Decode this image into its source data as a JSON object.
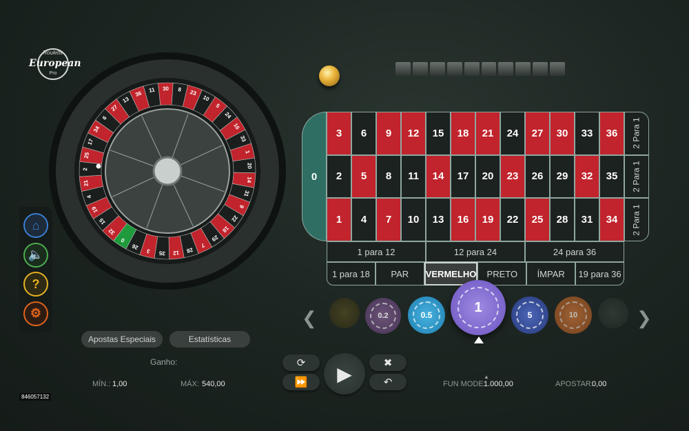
{
  "logo": {
    "top": "Roulette",
    "main": "European",
    "sub": "Pro"
  },
  "wheel": {
    "sequence": [
      0,
      32,
      15,
      19,
      4,
      21,
      2,
      25,
      17,
      34,
      6,
      27,
      13,
      36,
      11,
      30,
      8,
      23,
      10,
      5,
      24,
      16,
      33,
      1,
      20,
      14,
      31,
      9,
      22,
      18,
      29,
      7,
      28,
      12,
      35,
      3,
      26
    ],
    "red_numbers": [
      1,
      3,
      5,
      7,
      9,
      12,
      14,
      16,
      18,
      19,
      21,
      23,
      25,
      27,
      30,
      32,
      34,
      36
    ]
  },
  "table": {
    "zero": "0",
    "rows": [
      [
        3,
        6,
        9,
        12,
        15,
        18,
        21,
        24,
        27,
        30,
        33,
        36
      ],
      [
        2,
        5,
        8,
        11,
        14,
        17,
        20,
        23,
        26,
        29,
        32,
        35
      ],
      [
        1,
        4,
        7,
        10,
        13,
        16,
        19,
        22,
        25,
        28,
        31,
        34
      ]
    ],
    "column_bets": [
      "2 Para 1",
      "2 Para 1",
      "2 Para 1"
    ],
    "dozens": [
      "1 para 12",
      "12 para 24",
      "24 para 36"
    ],
    "outside": [
      "1 para 18",
      "PAR",
      "VERMELHO",
      "PRETO",
      "ÍMPAR",
      "19 para 36"
    ],
    "selected_outside": "VERMELHO"
  },
  "chips": {
    "values": [
      "0.2",
      "0.5",
      "1",
      "5",
      "10"
    ],
    "selected": "1",
    "prev_icon": "chevron-left-icon",
    "next_icon": "chevron-right-icon"
  },
  "side_menu": [
    "home-icon",
    "sound-icon",
    "help-icon",
    "settings-icon"
  ],
  "buttons": {
    "special_bets": "Apostas Especiais",
    "statistics": "Estatísticas"
  },
  "info": {
    "win_label": "Ganho:",
    "min_label": "MÍN.:",
    "min_value": "1,00",
    "max_label": "MÁX:",
    "max_value": "540,00",
    "fun_mode_label": "FUN MODE:",
    "fun_mode_value": "1.000,00",
    "bet_label": "APOSTAR:",
    "bet_value": "0,00",
    "game_id": "846057132"
  },
  "controls": [
    "repeat-icon",
    "fast-forward-icon",
    "play-icon",
    "clear-icon",
    "undo-icon"
  ],
  "colors": {
    "red": "#c1242c",
    "black": "#1c2220",
    "green": "#2f6e63",
    "felt": "#1d2622"
  }
}
